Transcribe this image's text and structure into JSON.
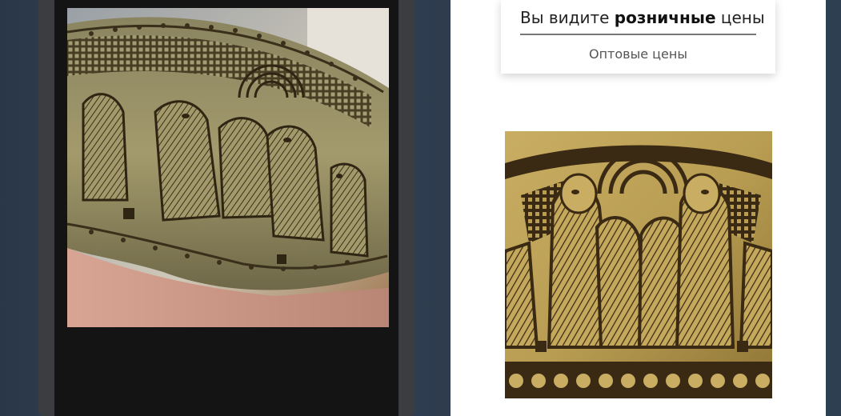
{
  "price_toggle": {
    "retail_prefix": "Вы видите",
    "retail_bold": "розничные",
    "retail_suffix": "цены",
    "wholesale_label": "Оптовые цены"
  },
  "left_photo": {
    "subject": "engraved-brass-bracelet-held-in-hand"
  },
  "right_photo": {
    "subject": "engraved-brass-bracelet-closeup"
  },
  "colors": {
    "page_background": "#2f3d4f",
    "brass": "#b29a53",
    "engraving": "#3a2a14",
    "divider": "#777777"
  }
}
